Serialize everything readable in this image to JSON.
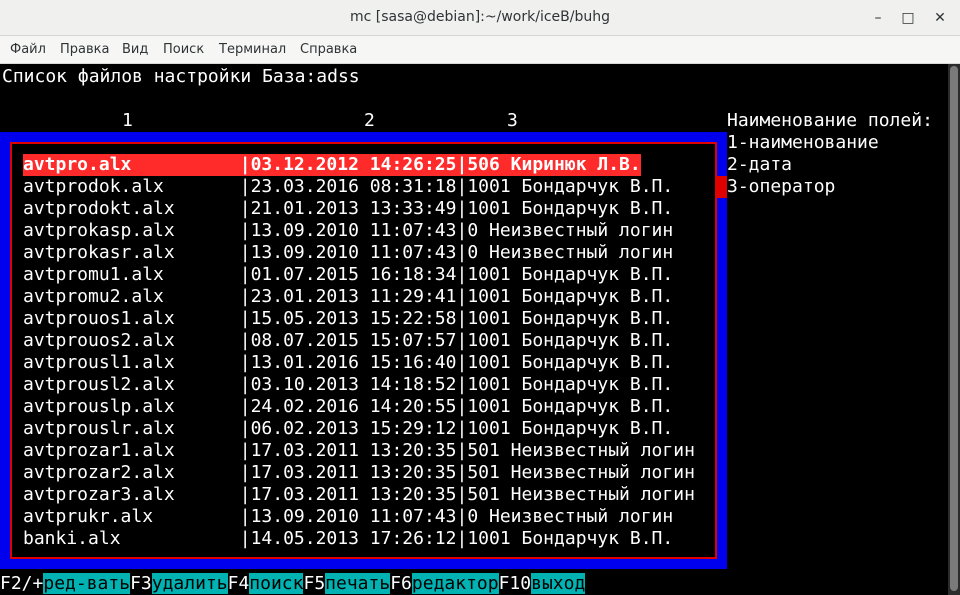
{
  "window": {
    "title": "mc [sasa@debian]:~/work/iceB/buhg"
  },
  "menu": [
    "Файл",
    "Правка",
    "Вид",
    "Поиск",
    "Терминал",
    "Справка"
  ],
  "header": "Список файлов настройки База:adss",
  "columns": [
    "1",
    "2",
    "3"
  ],
  "legend": {
    "title": "Наименование полей:",
    "items": [
      "1-наименование",
      "2-дата",
      "3-оператор"
    ]
  },
  "rows": [
    {
      "name": "avtpro.alx",
      "date": "03.12.2012 14:26:25",
      "op": "506 Киринюк Л.В.",
      "selected": true
    },
    {
      "name": "avtprodok.alx",
      "date": "23.03.2016 08:31:18",
      "op": "1001 Бондарчук В.П."
    },
    {
      "name": "avtprodokt.alx",
      "date": "21.01.2013 13:33:49",
      "op": "1001 Бондарчук В.П."
    },
    {
      "name": "avtprokasp.alx",
      "date": "13.09.2010 11:07:43",
      "op": "0 Неизвестный логин"
    },
    {
      "name": "avtprokasr.alx",
      "date": "13.09.2010 11:07:43",
      "op": "0 Неизвестный логин"
    },
    {
      "name": "avtpromu1.alx",
      "date": "01.07.2015 16:18:34",
      "op": "1001 Бондарчук В.П."
    },
    {
      "name": "avtpromu2.alx",
      "date": "23.01.2013 11:29:41",
      "op": "1001 Бондарчук В.П."
    },
    {
      "name": "avtprouos1.alx",
      "date": "15.05.2013 15:22:58",
      "op": "1001 Бондарчук В.П."
    },
    {
      "name": "avtprouos2.alx",
      "date": "08.07.2015 15:07:57",
      "op": "1001 Бондарчук В.П."
    },
    {
      "name": "avtprousl1.alx",
      "date": "13.01.2016 15:16:40",
      "op": "1001 Бондарчук В.П."
    },
    {
      "name": "avtprousl2.alx",
      "date": "03.10.2013 14:18:52",
      "op": "1001 Бондарчук В.П."
    },
    {
      "name": "avtprouslp.alx",
      "date": "24.02.2016 14:20:55",
      "op": "1001 Бондарчук В.П."
    },
    {
      "name": "avtprouslr.alx",
      "date": "06.02.2013 15:29:12",
      "op": "1001 Бондарчук В.П."
    },
    {
      "name": "avtprozar1.alx",
      "date": "17.03.2011 13:20:35",
      "op": "501 Неизвестный логин"
    },
    {
      "name": "avtprozar2.alx",
      "date": "17.03.2011 13:20:35",
      "op": "501 Неизвестный логин"
    },
    {
      "name": "avtprozar3.alx",
      "date": "17.03.2011 13:20:35",
      "op": "501 Неизвестный логин"
    },
    {
      "name": "avtprukr.alx",
      "date": "13.09.2010 11:07:43",
      "op": "0 Неизвестный логин"
    },
    {
      "name": "banki.alx",
      "date": "14.05.2013 17:26:12",
      "op": "1001 Бондарчук В.П."
    }
  ],
  "fkeys": [
    {
      "key": "F2/+",
      "label": "ред-вать"
    },
    {
      "key": "F3",
      "label": "удалить"
    },
    {
      "key": "F4",
      "label": "поиск"
    },
    {
      "key": "F5",
      "label": "печать"
    },
    {
      "key": "F6",
      "label": "редактор"
    },
    {
      "key": "F10",
      "label": "выход"
    }
  ],
  "colors": {
    "frame": "#0000ee",
    "border": "#e00000",
    "selection": "#ff2a2a",
    "fkey_label_bg": "#00b2b2"
  }
}
